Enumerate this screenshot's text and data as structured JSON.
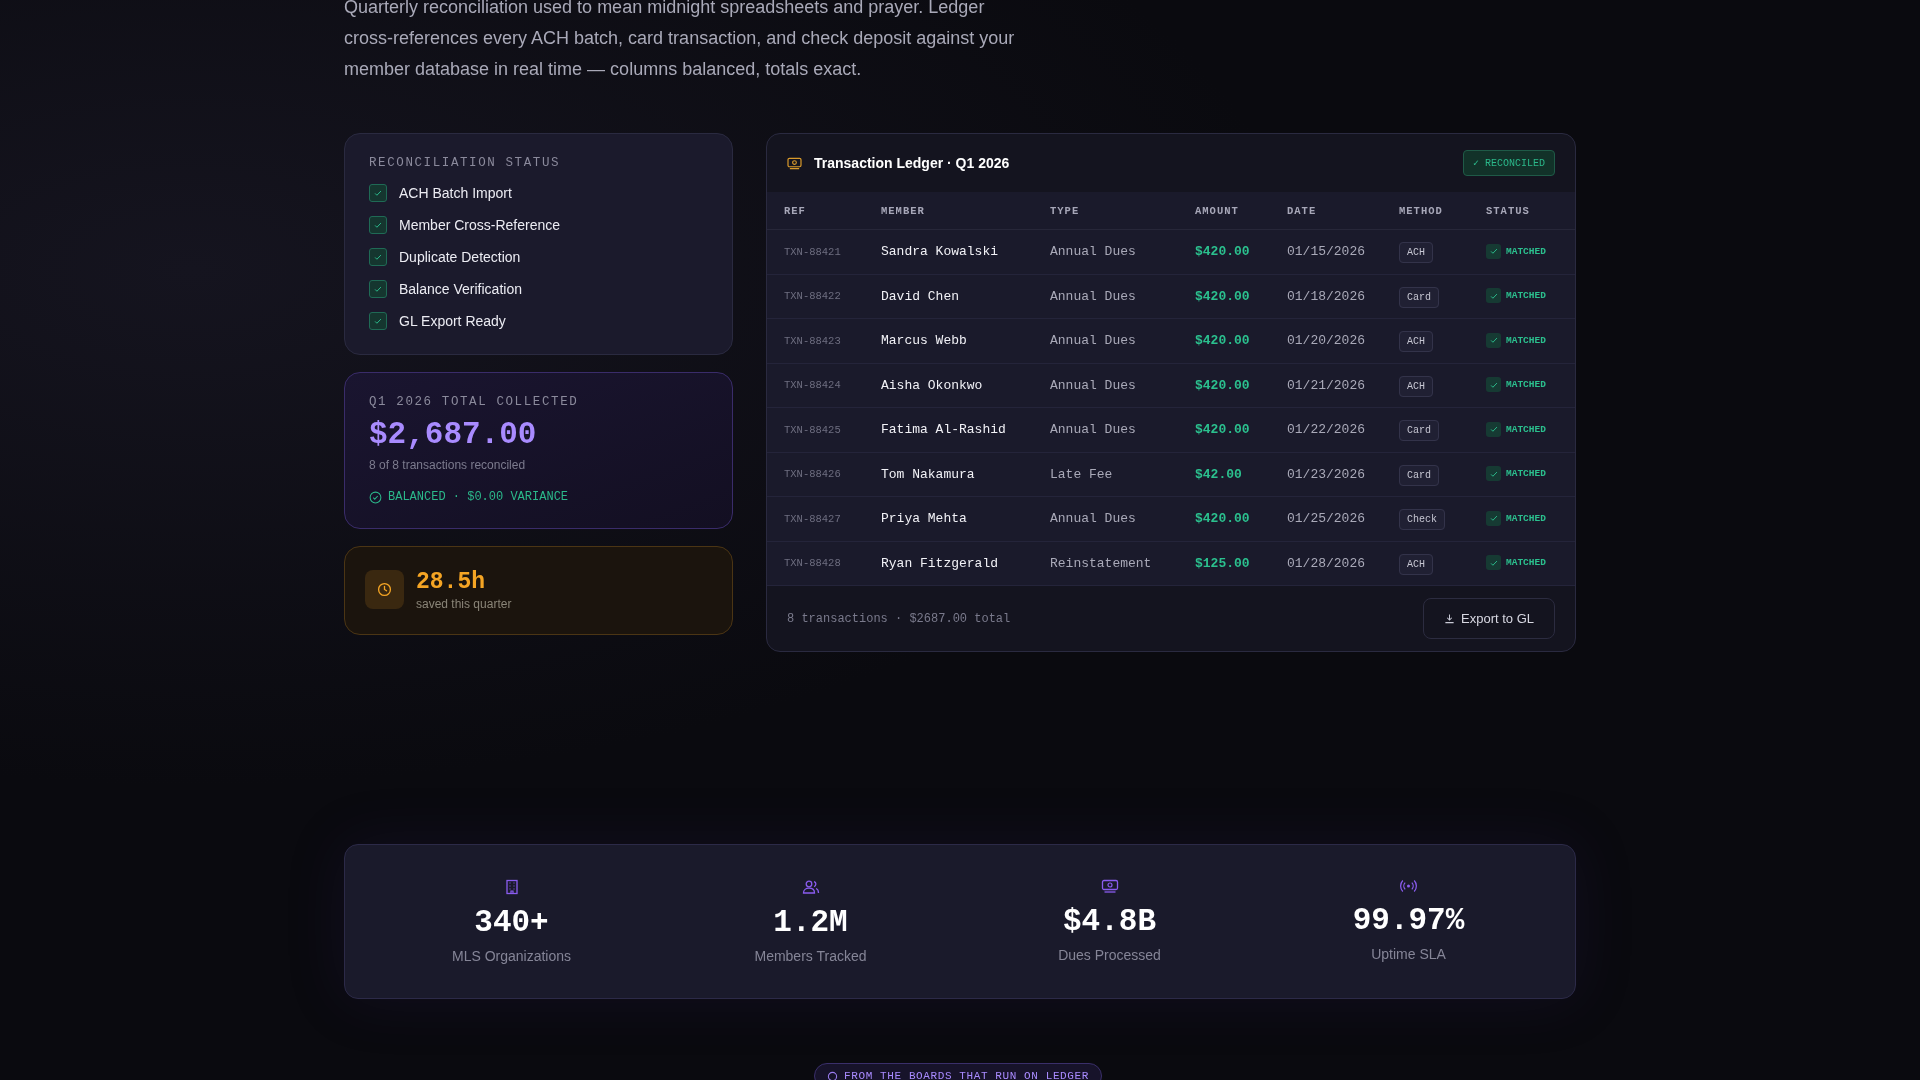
{
  "intro": "Quarterly reconciliation used to mean midnight spreadsheets and prayer. Ledger cross-references every ACH batch, card transaction, and check deposit against your member database in real time — columns balanced, totals exact.",
  "status_card": {
    "heading": "RECONCILIATION STATUS",
    "items": [
      {
        "label": "ACH Batch Import",
        "checked": true
      },
      {
        "label": "Member Cross-Reference",
        "checked": true
      },
      {
        "label": "Duplicate Detection",
        "checked": true
      },
      {
        "label": "Balance Verification",
        "checked": true
      },
      {
        "label": "GL Export Ready",
        "checked": true
      }
    ]
  },
  "total_card": {
    "heading": "Q1 2026 TOTAL COLLECTED",
    "amount": "$2,687.00",
    "subtitle": "8 of 8 transactions reconciled",
    "balance": "BALANCED · $0.00 VARIANCE"
  },
  "saved_card": {
    "value": "28.5h",
    "caption": "saved this quarter"
  },
  "ledger": {
    "title": "Transaction Ledger · Q1 2026",
    "badge": "✓ RECONCILED",
    "columns": [
      "REF",
      "MEMBER",
      "TYPE",
      "AMOUNT",
      "DATE",
      "METHOD",
      "STATUS"
    ],
    "rows": [
      {
        "ref": "TXN-88421",
        "member": "Sandra Kowalski",
        "type": "Annual Dues",
        "amount": "$420.00",
        "date": "01/15/2026",
        "method": "ACH",
        "status": "MATCHED",
        "matched": true
      },
      {
        "ref": "TXN-88422",
        "member": "David Chen",
        "type": "Annual Dues",
        "amount": "$420.00",
        "date": "01/18/2026",
        "method": "Card",
        "status": "MATCHED",
        "matched": true
      },
      {
        "ref": "TXN-88423",
        "member": "Marcus Webb",
        "type": "Annual Dues",
        "amount": "$420.00",
        "date": "01/20/2026",
        "method": "ACH",
        "status": "MATCHED",
        "matched": true
      },
      {
        "ref": "TXN-88424",
        "member": "Aisha Okonkwo",
        "type": "Annual Dues",
        "amount": "$420.00",
        "date": "01/21/2026",
        "method": "ACH",
        "status": "MATCHED",
        "matched": true
      },
      {
        "ref": "TXN-88425",
        "member": "Fatima Al-Rashid",
        "type": "Annual Dues",
        "amount": "$420.00",
        "date": "01/22/2026",
        "method": "Card",
        "status": "MATCHED",
        "matched": true
      },
      {
        "ref": "TXN-88426",
        "member": "Tom Nakamura",
        "type": "Late Fee",
        "amount": "$42.00",
        "date": "01/23/2026",
        "method": "Card",
        "status": "MATCHED",
        "matched": true
      },
      {
        "ref": "TXN-88427",
        "member": "Priya Mehta",
        "type": "Annual Dues",
        "amount": "$420.00",
        "date": "01/25/2026",
        "method": "Check",
        "status": "MATCHED",
        "matched": true
      },
      {
        "ref": "TXN-88428",
        "member": "Ryan Fitzgerald",
        "type": "Reinstatement",
        "amount": "$125.00",
        "date": "01/28/2026",
        "method": "ACH",
        "status": "MATCHED",
        "matched": true
      }
    ],
    "footer": "8 transactions · $2687.00 total",
    "export_button": "Export to GL"
  },
  "stats": [
    {
      "value": "340+",
      "label": "MLS Organizations"
    },
    {
      "value": "1.2M",
      "label": "Members Tracked"
    },
    {
      "value": "$4.8B",
      "label": "Dues Processed"
    },
    {
      "value": "99.97%",
      "label": "Uptime SLA"
    }
  ],
  "bottom_badge": "FROM THE BOARDS THAT RUN ON LEDGER"
}
